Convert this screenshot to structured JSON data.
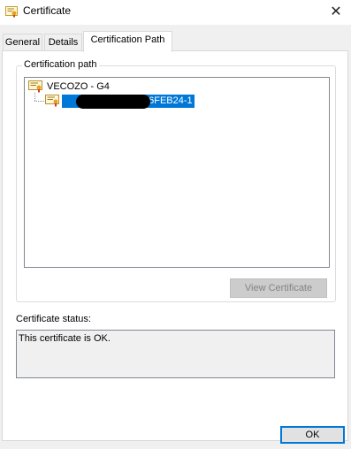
{
  "window": {
    "title": "Certificate",
    "close_glyph": "✕"
  },
  "tabs": [
    {
      "label": "General"
    },
    {
      "label": "Details"
    },
    {
      "label": "Certification Path",
      "active": true
    }
  ],
  "cert_path": {
    "group_label": "Certification path",
    "nodes": [
      {
        "label": "VECOZO - G4",
        "icon": "certificate-icon"
      },
      {
        "label_visible_suffix": "16FEB24-1",
        "icon": "certificate-icon",
        "selected": true,
        "redacted": true
      }
    ],
    "view_button_label": "View Certificate"
  },
  "status": {
    "label": "Certificate status:",
    "text": "This certificate is OK."
  },
  "footer": {
    "ok_label": "OK"
  },
  "colors": {
    "selection": "#0078d7",
    "dialog_bg": "#f0f0f0",
    "panel_bg": "#ffffff"
  }
}
